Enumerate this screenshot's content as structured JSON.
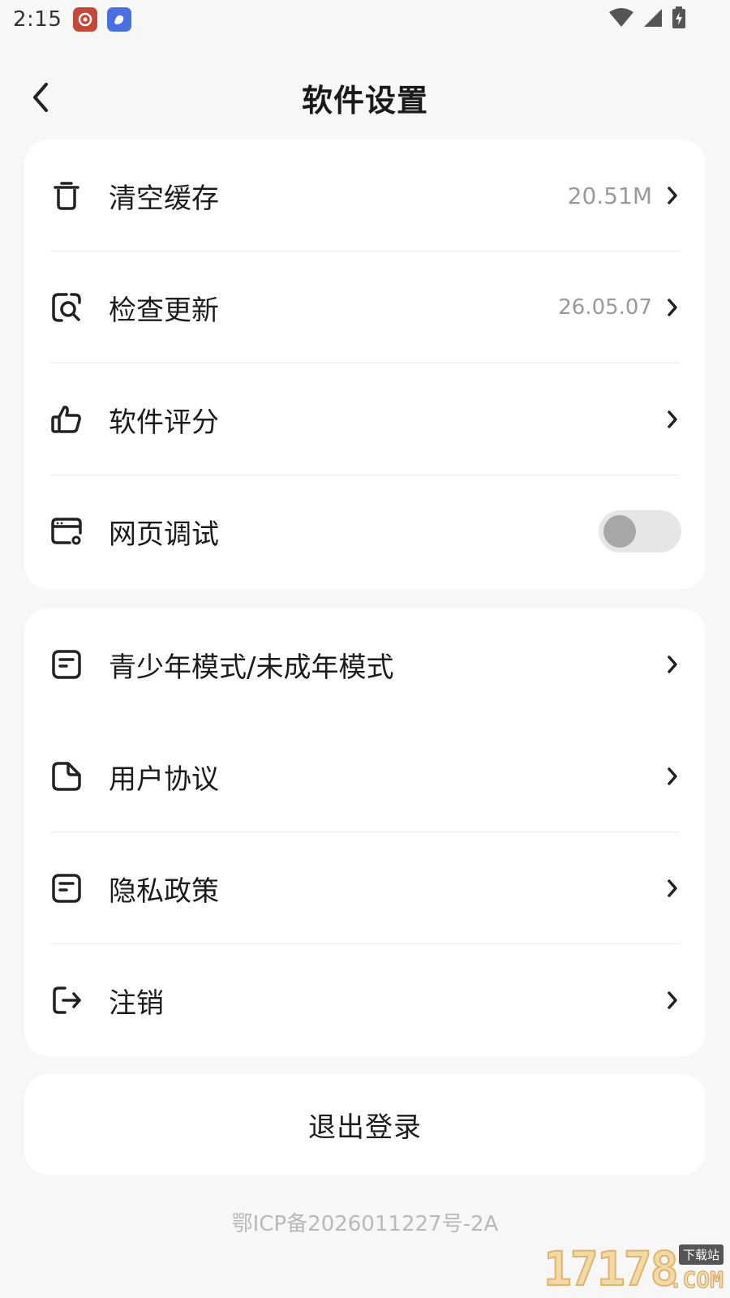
{
  "status_bar": {
    "time": "2:15",
    "icons": [
      "weibo-app-icon",
      "bird-app-icon",
      "wifi-icon",
      "signal-icon",
      "battery-charging-icon"
    ]
  },
  "header": {
    "title": "软件设置",
    "back_icon": "back-chevron-icon"
  },
  "settings_group_1": [
    {
      "icon": "trash-icon",
      "label": "清空缓存",
      "value": "20.51M",
      "control": "chevron"
    },
    {
      "icon": "search-page-icon",
      "label": "检查更新",
      "value": "26.05.07",
      "control": "chevron"
    },
    {
      "icon": "thumbs-up-icon",
      "label": "软件评分",
      "value": "",
      "control": "chevron"
    },
    {
      "icon": "web-debug-icon",
      "label": "网页调试",
      "value": "",
      "control": "toggle",
      "toggle_on": false
    }
  ],
  "settings_group_2": [
    {
      "icon": "document-icon",
      "label": "青少年模式/未成年模式",
      "control": "chevron"
    },
    {
      "icon": "file-icon",
      "label": "用户协议",
      "control": "chevron"
    },
    {
      "icon": "document-icon",
      "label": "隐私政策",
      "control": "chevron"
    },
    {
      "icon": "logout-icon",
      "label": "注销",
      "control": "chevron"
    }
  ],
  "logout": {
    "label": "退出登录"
  },
  "footer": {
    "icp": "鄂ICP备2026011227号-2A"
  },
  "watermark": {
    "digits": "17178",
    "suffix": ".COM",
    "tag": "下载站"
  },
  "colors": {
    "background": "#f7f7f7",
    "card": "#ffffff",
    "muted_text": "#999999",
    "toggle_track": "#e6e6e6"
  }
}
